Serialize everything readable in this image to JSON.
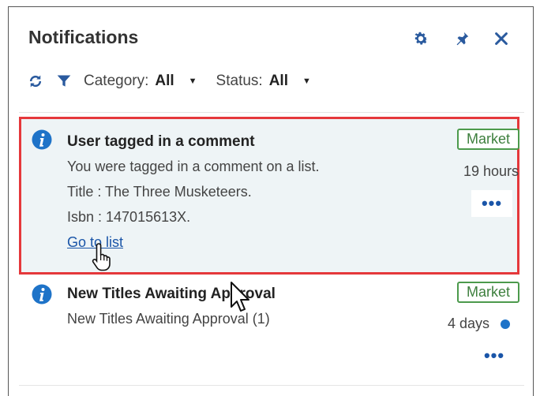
{
  "header": {
    "title": "Notifications",
    "icons": [
      "gear-icon",
      "pin-icon",
      "close-icon"
    ]
  },
  "filters": {
    "category_label": "Category:",
    "category_value": "All",
    "status_label": "Status:",
    "status_value": "All"
  },
  "notifications": [
    {
      "title": "User tagged in a comment",
      "lines": [
        "You were tagged in a comment on a list.",
        "Title : The Three Musketeers.",
        "Isbn : 147015613X."
      ],
      "link": "Go to list",
      "badge": "Market",
      "time": "19 hours",
      "more": "•••",
      "highlighted": true,
      "unread": false
    },
    {
      "title": "New Titles Awaiting Approval",
      "lines": [
        "New Titles Awaiting Approval (1)"
      ],
      "badge": "Market",
      "time": "4 days",
      "more": "•••",
      "highlighted": false,
      "unread": true
    }
  ],
  "colors": {
    "accent": "#1e73c8",
    "highlight_border": "#e5383b",
    "badge_green": "#4c9a4c",
    "card_bg": "#eef4f6"
  }
}
